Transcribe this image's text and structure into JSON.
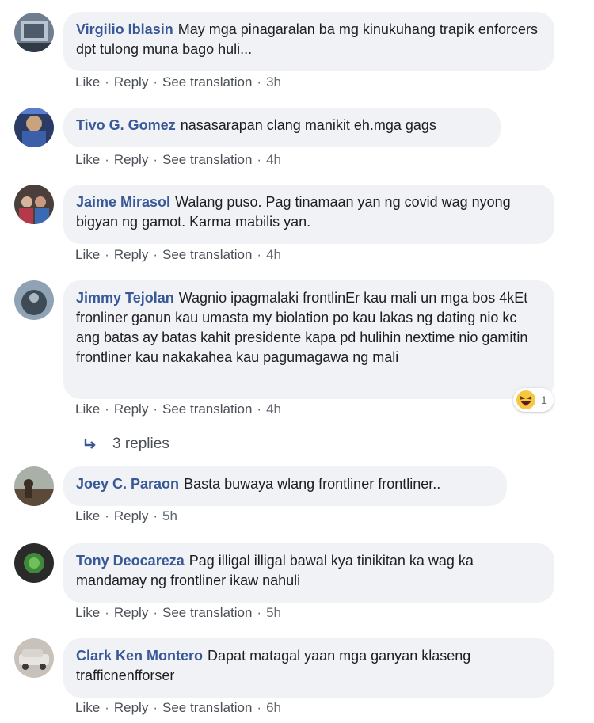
{
  "comments": [
    {
      "author": "Virgilio Iblasin",
      "text": "May mga pinagaralan ba mg kinukuhang trapik enforcers dpt tulong muna bago huli...",
      "like": "Like",
      "reply": "Reply",
      "translate": "See translation",
      "time": "3h"
    },
    {
      "author": "Tivo G. Gomez",
      "text": "nasasarapan clang manikit eh.mga gags",
      "like": "Like",
      "reply": "Reply",
      "translate": "See translation",
      "time": "4h"
    },
    {
      "author": "Jaime Mirasol",
      "text": "Walang puso. Pag tinamaan yan ng covid wag nyong bigyan ng gamot. Karma mabilis yan.",
      "like": "Like",
      "reply": "Reply",
      "translate": "See translation",
      "time": "4h"
    },
    {
      "author": "Jimmy Tejolan",
      "text": "Wagnio ipagmalaki frontlinEr kau mali un mga bos 4kEt fronliner ganun kau umasta my biolation po kau lakas ng dating nio kc ang batas ay batas kahit presidente kapa pd hulihin nextime nio gamitin frontliner kau nakakahea kau pagumagawa ng mali",
      "like": "Like",
      "reply": "Reply",
      "translate": "See translation",
      "time": "4h",
      "reaction_count": "1",
      "replies_label": "3 replies"
    },
    {
      "author": "Joey C. Paraon",
      "text": "Basta buwaya wlang frontliner frontliner..",
      "like": "Like",
      "reply": "Reply",
      "time": "5h"
    },
    {
      "author": "Tony Deocareza",
      "text": "Pag illigal illigal bawal kya tinikitan ka wag ka mandamay ng frontliner ikaw nahuli",
      "like": "Like",
      "reply": "Reply",
      "translate": "See translation",
      "time": "5h"
    },
    {
      "author": "Clark Ken Montero",
      "text": "Dapat matagal yaan mga ganyan klaseng trafficnenfforser",
      "like": "Like",
      "reply": "Reply",
      "translate": "See translation",
      "time": "6h"
    }
  ],
  "colors": {
    "author": "#385898",
    "bubble": "#f0f2f5",
    "meta": "#606770"
  },
  "icons": {
    "reaction": "haha-reaction-icon",
    "replies": "reply-arrow-icon"
  }
}
